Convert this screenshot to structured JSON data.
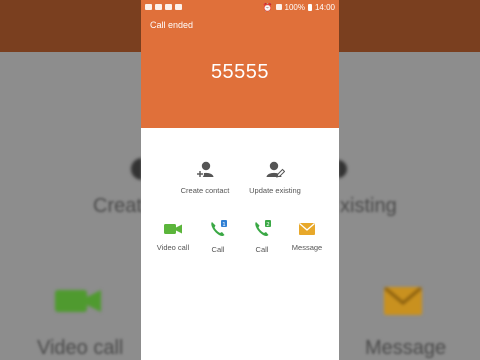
{
  "status_bar": {
    "battery": "100%",
    "time": "14:00"
  },
  "call": {
    "status": "Call ended",
    "number": "55555"
  },
  "contact_actions": [
    {
      "label": "Create contact",
      "icon": "person-add-icon"
    },
    {
      "label": "Update existing",
      "icon": "person-edit-icon"
    }
  ],
  "call_actions": [
    {
      "label": "Video call",
      "icon": "video-camera-icon"
    },
    {
      "label": "Call",
      "icon": "phone-sim1-icon"
    },
    {
      "label": "Call",
      "icon": "phone-sim2-icon"
    },
    {
      "label": "Message",
      "icon": "envelope-icon"
    }
  ],
  "background_echo": {
    "create": "Create",
    "existing": "xisting",
    "video_call": "Video call",
    "message": "Message"
  },
  "colors": {
    "accent": "#e0703a",
    "icon_gray": "#555555",
    "video_green": "#5bb53b",
    "call_green": "#3aa845",
    "message_yellow": "#e8a82a",
    "sim_blue": "#2f7fd4"
  }
}
